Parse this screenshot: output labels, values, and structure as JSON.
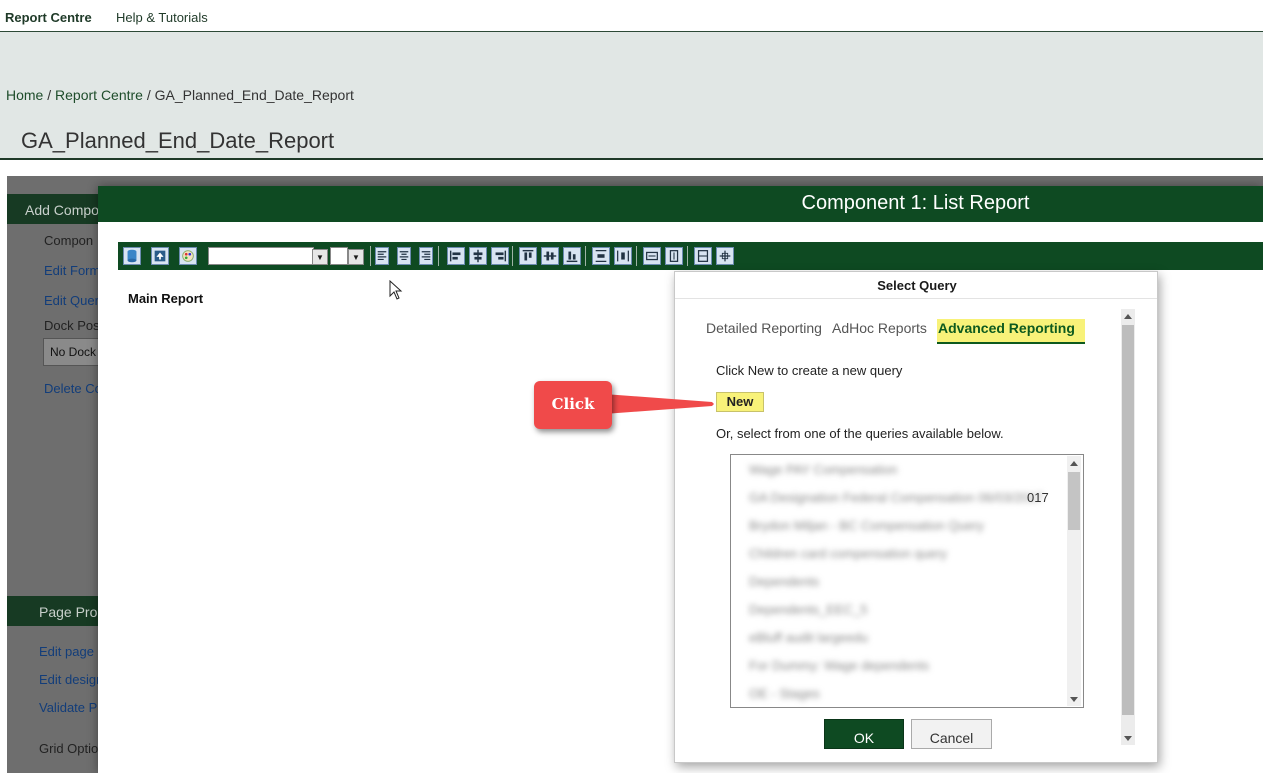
{
  "nav": {
    "items": [
      "Report Centre",
      "Help & Tutorials"
    ]
  },
  "breadcrumb": {
    "home": "Home",
    "report_centre": "Report Centre",
    "current": "GA_Planned_End_Date_Report",
    "sep": "/"
  },
  "page_title": "GA_Planned_End_Date_Report",
  "background": {
    "panel1_title": "Add Compo",
    "items1": [
      "Compon",
      "Edit Form",
      "Edit Quer",
      "Dock Pos",
      "Delete Co"
    ],
    "dock_value": "No Dock",
    "panel2_title": "Page Pro",
    "items2": [
      "Edit page",
      "Edit design",
      "Validate P",
      "Grid Optio"
    ]
  },
  "modal": {
    "title": "Component 1: List Report",
    "main_report_label": "Main Report"
  },
  "dialog": {
    "title": "Select Query",
    "tabs": [
      "Detailed Reporting",
      "AdHoc Reports",
      "Advanced Reporting"
    ],
    "instruction": "Click New to create a new query",
    "new_label": "New",
    "or_text": "Or, select from one of the queries available below.",
    "queries": [
      "Wage PAY Compensation",
      "GA Designation Federal Compensation 06/03/2017",
      "Brydon Miljan - BC Compensation Query",
      "Children card compensation query",
      "Dependents",
      "Dependents_EEC_5",
      "eBluff audit largeedu",
      "For Dummy: Wage dependents",
      "OE - Stages"
    ],
    "query_visible_suffix": "017",
    "ok_label": "OK",
    "cancel_label": "Cancel"
  },
  "callout": {
    "text": "Click"
  },
  "colors": {
    "brand_green": "#0e4a22",
    "highlight_yellow": "#f8f279",
    "callout_red": "#f04a4a"
  }
}
